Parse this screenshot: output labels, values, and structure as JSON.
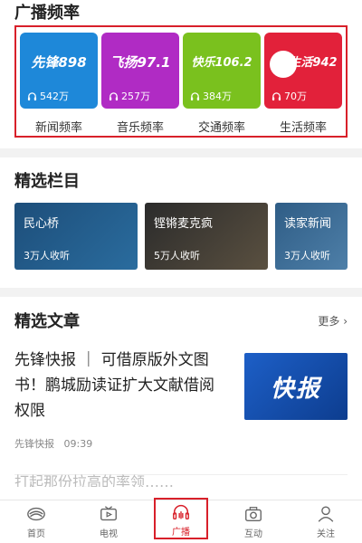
{
  "broadcast": {
    "title": "广播频率",
    "channels": [
      {
        "logo": "先锋898",
        "listeners": "542万",
        "name": "新闻频率",
        "color": "#1e88d9"
      },
      {
        "logo": "飞扬97.1",
        "listeners": "257万",
        "name": "音乐频率",
        "color": "#b02bc4"
      },
      {
        "logo": "快乐106.2",
        "listeners": "384万",
        "name": "交通频率",
        "color": "#7ac11e"
      },
      {
        "logo": "生活942",
        "listeners": "70万",
        "name": "生活频率",
        "color": "#e2213a"
      }
    ]
  },
  "programs": {
    "title": "精选栏目",
    "items": [
      {
        "name": "民心桥",
        "listeners": "3万人收听",
        "color": "#1d4e7a"
      },
      {
        "name": "铿锵麦克疯",
        "listeners": "5万人收听",
        "color": "#3a3a3a"
      },
      {
        "name": "读家新闻",
        "listeners": "3万人收听",
        "color": "#2f5d86"
      }
    ]
  },
  "articles": {
    "title": "精选文章",
    "more_label": "更多 ›",
    "items": [
      {
        "title": "先锋快报 ｜ 可借原版外文图书！鹏城励读证扩大文献借阅权限",
        "source": "先锋快报",
        "time": "09:39",
        "thumb_text": "快报"
      }
    ],
    "peek_text": "打起那份拉高的率领……"
  },
  "nav": {
    "items": [
      {
        "label": "首页",
        "icon": "home-logo-icon"
      },
      {
        "label": "电视",
        "icon": "tv-icon"
      },
      {
        "label": "广播",
        "icon": "radio-headphones-icon"
      },
      {
        "label": "互动",
        "icon": "camera-icon"
      },
      {
        "label": "关注",
        "icon": "user-icon"
      }
    ],
    "active": "广播",
    "accent_color": "#d8202a"
  }
}
